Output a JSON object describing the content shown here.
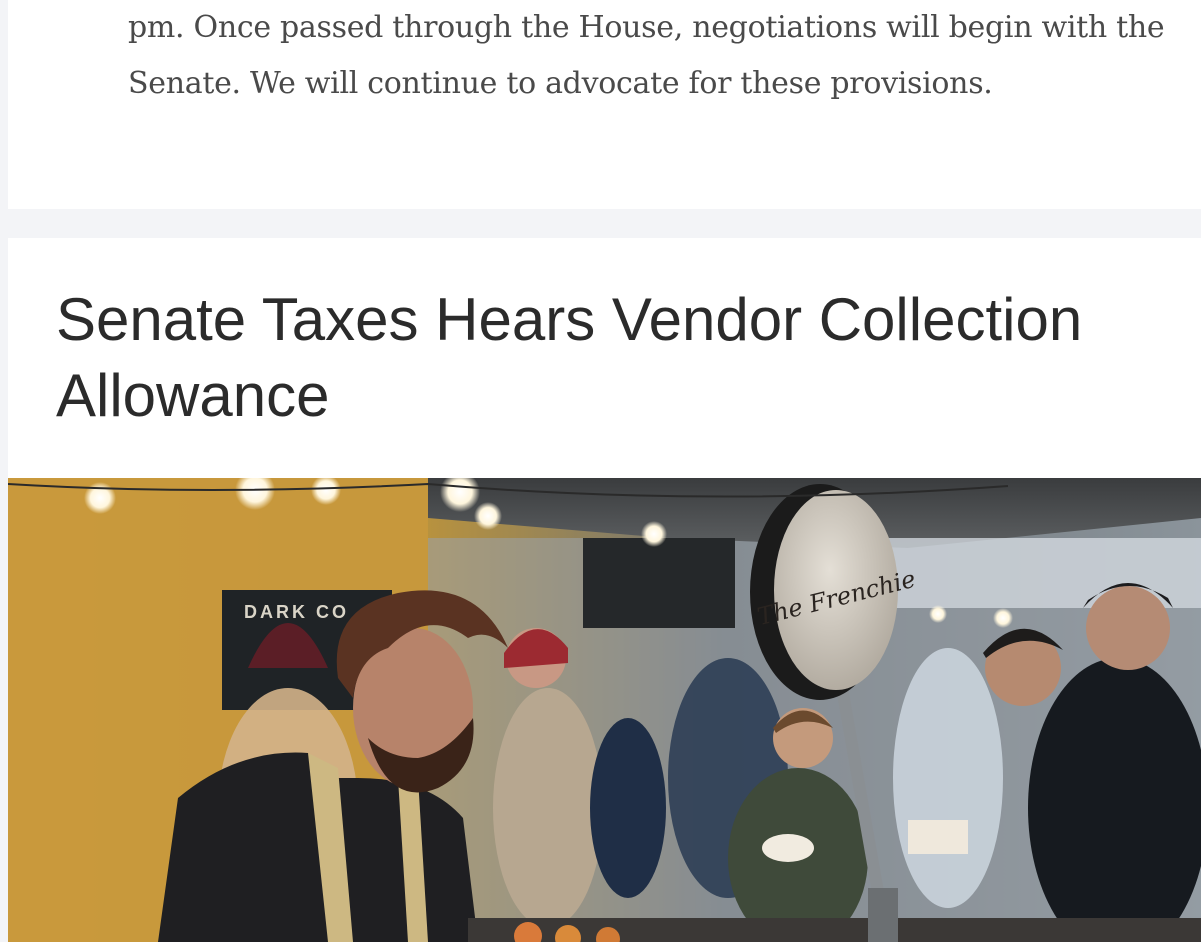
{
  "previous_post": {
    "excerpt_text": "pm. Once passed through the House, negotiations will begin with the Senate. We will continue to advocate for these provisions."
  },
  "post": {
    "title": "Senate Taxes Hears Vendor Collection Allowance",
    "image": {
      "sign_text": "The Frenchie",
      "banner_text": "DARK CO"
    }
  }
}
